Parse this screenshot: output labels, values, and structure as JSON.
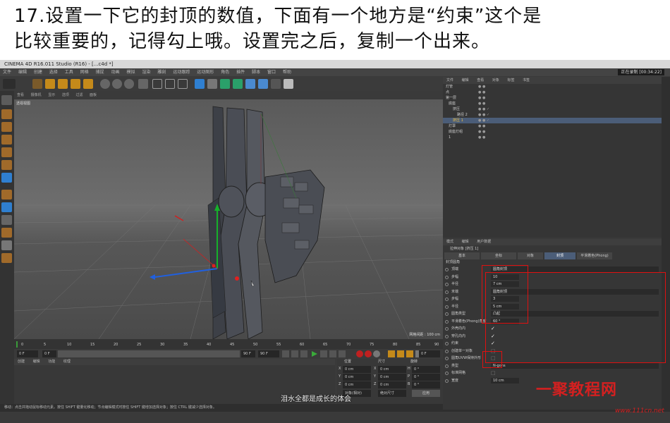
{
  "caption": {
    "line1": "17.设置一下它的封顶的数值，下面有一个地方是“约束”这个是",
    "line2": "比较重要的，记得勾上哦。设置完之后，复制一个出来。"
  },
  "app": {
    "title": "CINEMA 4D R16.011 Studio (R16) - [...c4d *]",
    "menus": [
      "文件",
      "编辑",
      "创建",
      "选择",
      "工具",
      "网格",
      "捕捉",
      "动画",
      "模拟",
      "渲染",
      "雕刻",
      "运动跟踪",
      "运动图形",
      "角色",
      "插件",
      "脚本",
      "窗口",
      "帮助"
    ],
    "recording": "正在录制 [00:34:22]"
  },
  "viewport": {
    "menus": [
      "查看",
      "摄像机",
      "显示",
      "选项",
      "过滤",
      "面板"
    ],
    "label": "透视视图",
    "grid": "网格间距 : 100 cm"
  },
  "timeline": {
    "ticks": [
      "0",
      "5",
      "10",
      "15",
      "20",
      "25",
      "30",
      "35",
      "40",
      "45",
      "50",
      "55",
      "60",
      "65",
      "70",
      "75",
      "80",
      "85",
      "90"
    ],
    "frame_start": "0 F",
    "frame_field": "0 F",
    "frame_end": "90 F",
    "frame_end2": "90 F",
    "current": "0 F"
  },
  "material": {
    "menus": [
      "创建",
      "编辑",
      "功能",
      "纹理"
    ]
  },
  "coords": {
    "headers": [
      "位置",
      "尺寸",
      "旋转"
    ],
    "rows": [
      {
        "a": "X",
        "v1": "0 cm",
        "b": "X",
        "v2": "0 cm",
        "c": "H",
        "v3": "0 °"
      },
      {
        "a": "Y",
        "v1": "0 cm",
        "b": "Y",
        "v2": "0 cm",
        "c": "P",
        "v3": "0 °"
      },
      {
        "a": "Z",
        "v1": "0 cm",
        "b": "Z",
        "v2": "0 cm",
        "c": "B",
        "v3": "0 °"
      }
    ],
    "mode": "对象(相对)",
    "mode2": "绝对尺寸",
    "apply": "应用"
  },
  "status": "移动：点击并拖动鼠标移动元素。按住 SHIFT 键量化移动；节点编辑模式时按住 SHIFT 键增加选择对象；按住 CTRL 键减少选择对象。",
  "objects": {
    "menus": [
      "文件",
      "编辑",
      "查看",
      "对象",
      "标签",
      "书签"
    ],
    "items": [
      "灯管",
      "点",
      "第一层",
      "底座",
      "挤压",
      "路径 2",
      "挤压 1",
      "灯罩",
      "底座灯组",
      "1"
    ]
  },
  "attributes": {
    "menus": [
      "模式",
      "编辑",
      "用户数据"
    ],
    "title": "拉伸对象 [挤压 1]",
    "tabs": [
      "基本",
      "坐标",
      "对象",
      "封顶",
      "平滑着色(Phong)"
    ],
    "section": "封顶圆角",
    "rows": [
      {
        "label": "顶端",
        "value": "圆角封顶"
      },
      {
        "label": "步幅",
        "value": "10"
      },
      {
        "label": "半径",
        "value": "7 cm"
      },
      {
        "label": "末端",
        "value": "圆角封顶"
      },
      {
        "label": "步幅",
        "value": "3"
      },
      {
        "label": "半径",
        "value": "5 cm"
      },
      {
        "label": "圆角类型",
        "value": "凸起"
      },
      {
        "label": "平滑着色(Phong)角度",
        "value": "60 °"
      },
      {
        "label": "外壳向内",
        "value": ""
      },
      {
        "label": "穿孔向内",
        "value": ""
      },
      {
        "label": "约束",
        "value": ""
      },
      {
        "label": "创建单一对象",
        "value": ""
      },
      {
        "label": "圆角UVW保持外形",
        "value": ""
      },
      {
        "label": "类型",
        "value": "N-gons"
      },
      {
        "label": "标准网格",
        "value": ""
      },
      {
        "label": "宽度",
        "value": "10 cm"
      }
    ]
  },
  "subtitle": "泪水全都是成长的体会",
  "watermark": {
    "main": "一聚教程网",
    "url": "www.111cn.net"
  },
  "colors": {
    "highlight_box": "#e01010",
    "active_tab": "#4b5d78",
    "watermark": "#d42020"
  }
}
